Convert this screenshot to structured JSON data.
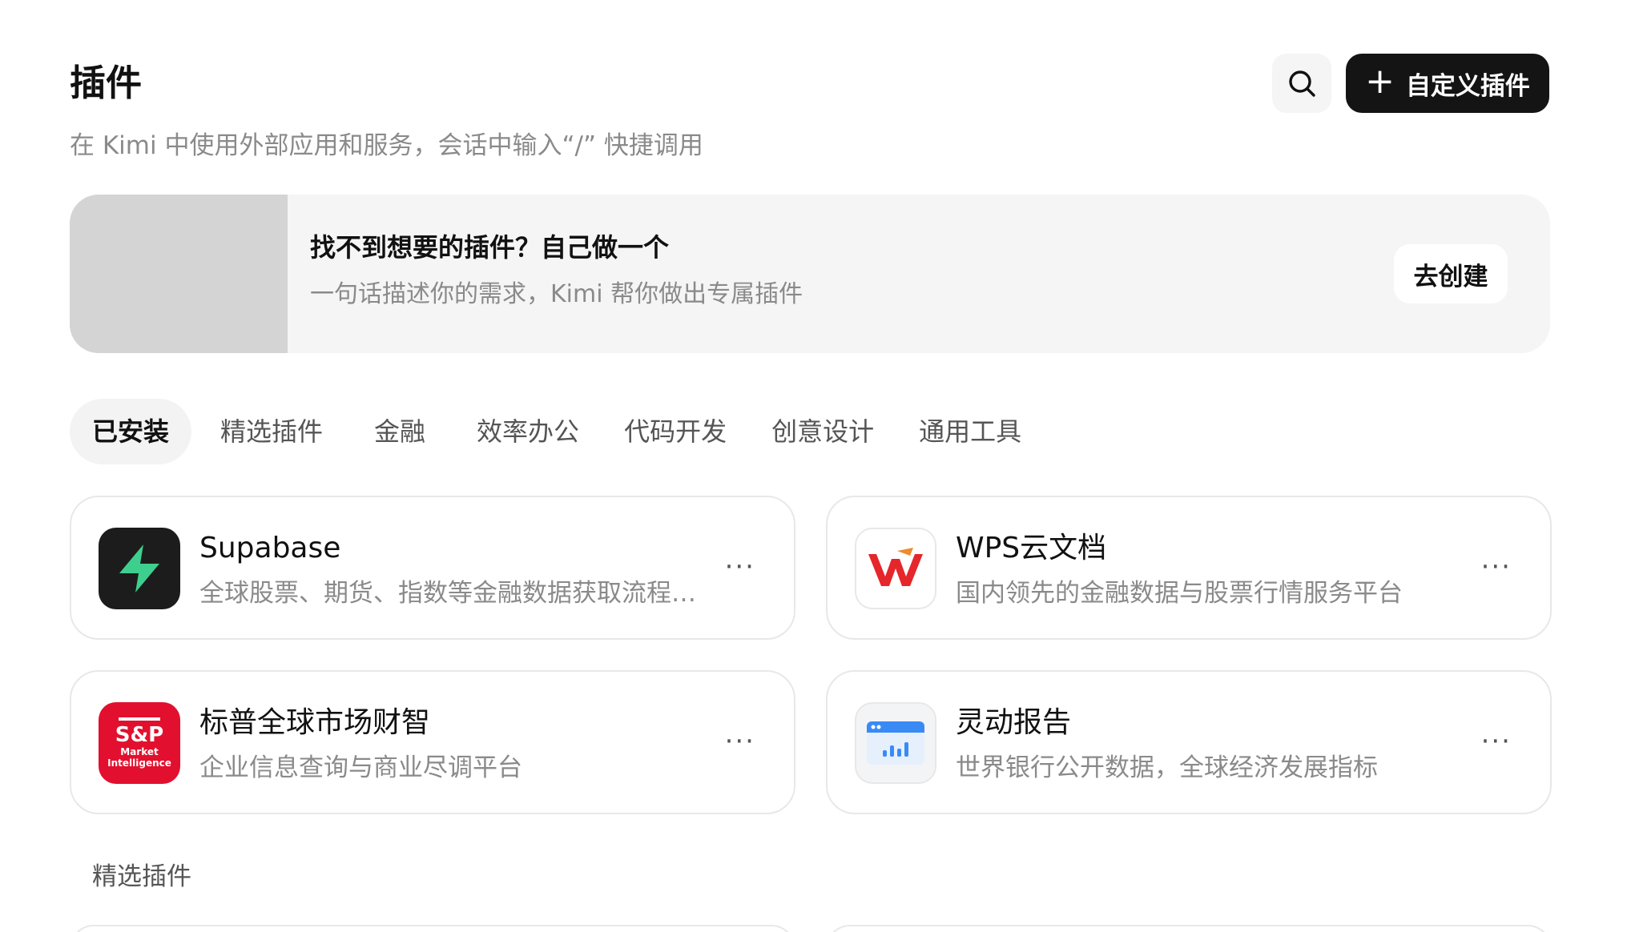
{
  "header": {
    "title": "插件",
    "subtitle": "在 Kimi 中使用外部应用和服务，会话中输入“/” 快捷调用",
    "search_icon": "search-icon",
    "custom_button_label": "自定义插件",
    "custom_button_icon": "plus-icon"
  },
  "banner": {
    "title": "找不到想要的插件？自己做一个",
    "description": "一句话描述你的需求，Kimi 帮你做出专属插件",
    "button_label": "去创建"
  },
  "tabs": [
    {
      "label": "已安装",
      "active": true
    },
    {
      "label": "精选插件",
      "active": false
    },
    {
      "label": "金融",
      "active": false
    },
    {
      "label": "效率办公",
      "active": false
    },
    {
      "label": "代码开发",
      "active": false
    },
    {
      "label": "创意设计",
      "active": false
    },
    {
      "label": "通用工具",
      "active": false
    }
  ],
  "installed": [
    {
      "name": "Supabase",
      "description": "全球股票、期货、指数等金融数据获取流程与分析工具",
      "icon": "supabase-logo-icon",
      "more": "···"
    },
    {
      "name": "WPS云文档",
      "description": "国内领先的金融数据与股票行情服务平台",
      "icon": "wps-logo-icon",
      "more": "···"
    },
    {
      "name": "标普全球市场财智",
      "description": "企业信息查询与商业尽调平台",
      "icon": "sp-logo-icon",
      "logo_main": "S&P",
      "logo_sub": "Market Intelligence",
      "more": "···"
    },
    {
      "name": "灵动报告",
      "description": "世界银行公开数据，全球经济发展指标",
      "icon": "report-chart-icon",
      "more": "···"
    }
  ],
  "section": {
    "title": "精选插件"
  },
  "colors": {
    "primary_button": "#141414",
    "banner_bg": "#f5f5f5",
    "sp_red": "#e2102e",
    "supabase_green": "#3ecf8e",
    "wps_red": "#e5262b"
  }
}
